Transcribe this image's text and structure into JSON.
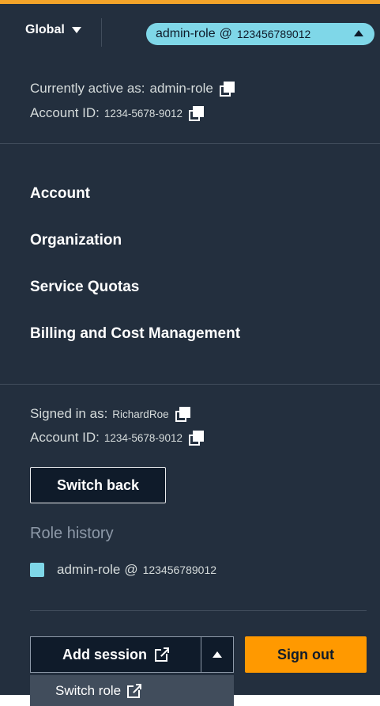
{
  "header": {
    "region_label": "Global",
    "role_pill": {
      "role": "admin-role",
      "at": "@",
      "account": "123456789012"
    }
  },
  "current": {
    "active_label": "Currently active as:",
    "active_value": "admin-role",
    "account_label": "Account ID:",
    "account_value": "1234-5678-9012"
  },
  "menu": {
    "items": [
      {
        "label": "Account"
      },
      {
        "label": "Organization"
      },
      {
        "label": "Service Quotas"
      },
      {
        "label": "Billing and Cost Management"
      }
    ]
  },
  "signed": {
    "label": "Signed in as:",
    "value": "RichardRoe",
    "account_label": "Account ID:",
    "account_value": "1234-5678-9012"
  },
  "switch_back_label": "Switch back",
  "role_history": {
    "heading": "Role history",
    "items": [
      {
        "role": "admin-role",
        "at": "@",
        "account": "123456789012",
        "color": "#7fd7e8"
      }
    ]
  },
  "footer": {
    "add_session_label": "Add session",
    "sign_out_label": "Sign out",
    "dropdown_item_label": "Switch role"
  },
  "colors": {
    "panel": "#232f3e",
    "accent_cyan": "#7fd7e8",
    "sign_out_orange": "#ff9900"
  }
}
